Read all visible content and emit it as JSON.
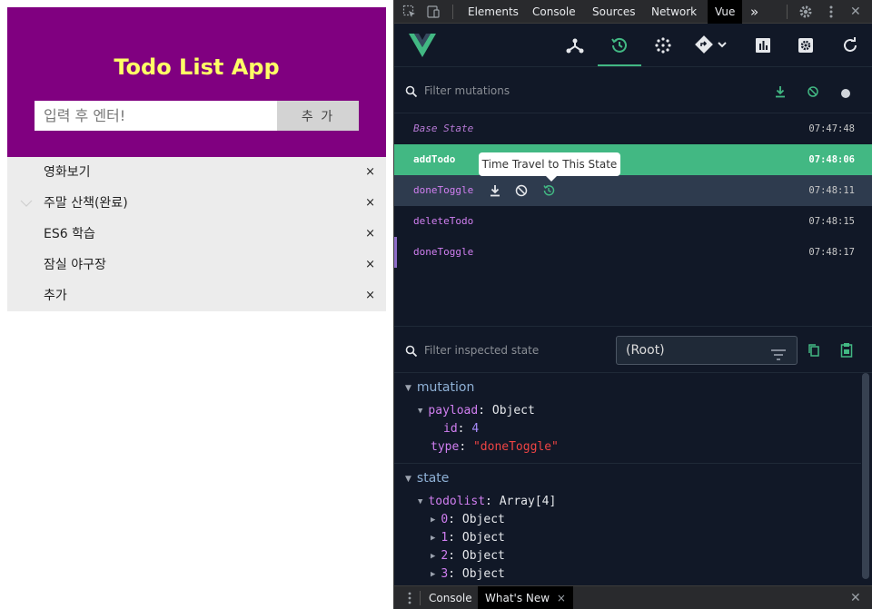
{
  "todo_app": {
    "title": "Todo List App",
    "input_placeholder": "입력 후 엔터!",
    "add_label": "추 가",
    "delete_glyph": "×",
    "items": [
      {
        "text": "영화보기",
        "done": false
      },
      {
        "text": "주말 산책(완료)",
        "done": true
      },
      {
        "text": "ES6 학습",
        "done": false
      },
      {
        "text": "잠실 야구장",
        "done": false
      },
      {
        "text": "추가",
        "done": false
      }
    ]
  },
  "devtools": {
    "tabs": [
      {
        "label": "Elements"
      },
      {
        "label": "Console"
      },
      {
        "label": "Sources"
      },
      {
        "label": "Network"
      },
      {
        "label": "Vue",
        "active": true
      }
    ],
    "more_glyph": "»",
    "close_glyph": "✕",
    "vue_toolbar": {
      "icons": [
        "components-icon",
        "vuex-icon",
        "events-icon",
        "router-icon",
        "performance-icon",
        "settings-icon",
        "refresh-icon"
      ],
      "active": "vuex-icon"
    },
    "mutation_filter_placeholder": "Filter mutations",
    "mutations": [
      {
        "name": "Base State",
        "time": "07:47:48",
        "state": "base"
      },
      {
        "name": "addTodo",
        "time": "07:48:06",
        "state": "active"
      },
      {
        "name": "doneToggle",
        "time": "07:48:11",
        "state": "hover"
      },
      {
        "name": "deleteTodo",
        "time": "07:48:15",
        "state": "normal"
      },
      {
        "name": "doneToggle",
        "time": "07:48:17",
        "state": "marked"
      }
    ],
    "tooltip": "Time Travel to This State",
    "state_filter_placeholder": "Filter inspected state",
    "root_select": "(Root)",
    "inspector": {
      "mutation_label": "mutation",
      "payload_key": "payload",
      "payload_type": "Object",
      "id_key": "id",
      "id_value": "4",
      "type_key": "type",
      "type_value": "\"doneToggle\"",
      "state_label": "state",
      "todolist_key": "todolist",
      "todolist_type": "Array[4]",
      "entries": [
        {
          "key": "0",
          "type": "Object"
        },
        {
          "key": "1",
          "type": "Object"
        },
        {
          "key": "2",
          "type": "Object"
        },
        {
          "key": "3",
          "type": "Object"
        }
      ]
    },
    "drawer": {
      "tabs": [
        {
          "label": "Console"
        },
        {
          "label": "What's New",
          "active": true
        }
      ],
      "tab_close_glyph": "×",
      "close_glyph": "✕"
    }
  },
  "colors": {
    "app_header": "#800080",
    "app_title": "#ffff66",
    "vue_green": "#42b883",
    "mutation_name": "#d17ff1"
  }
}
